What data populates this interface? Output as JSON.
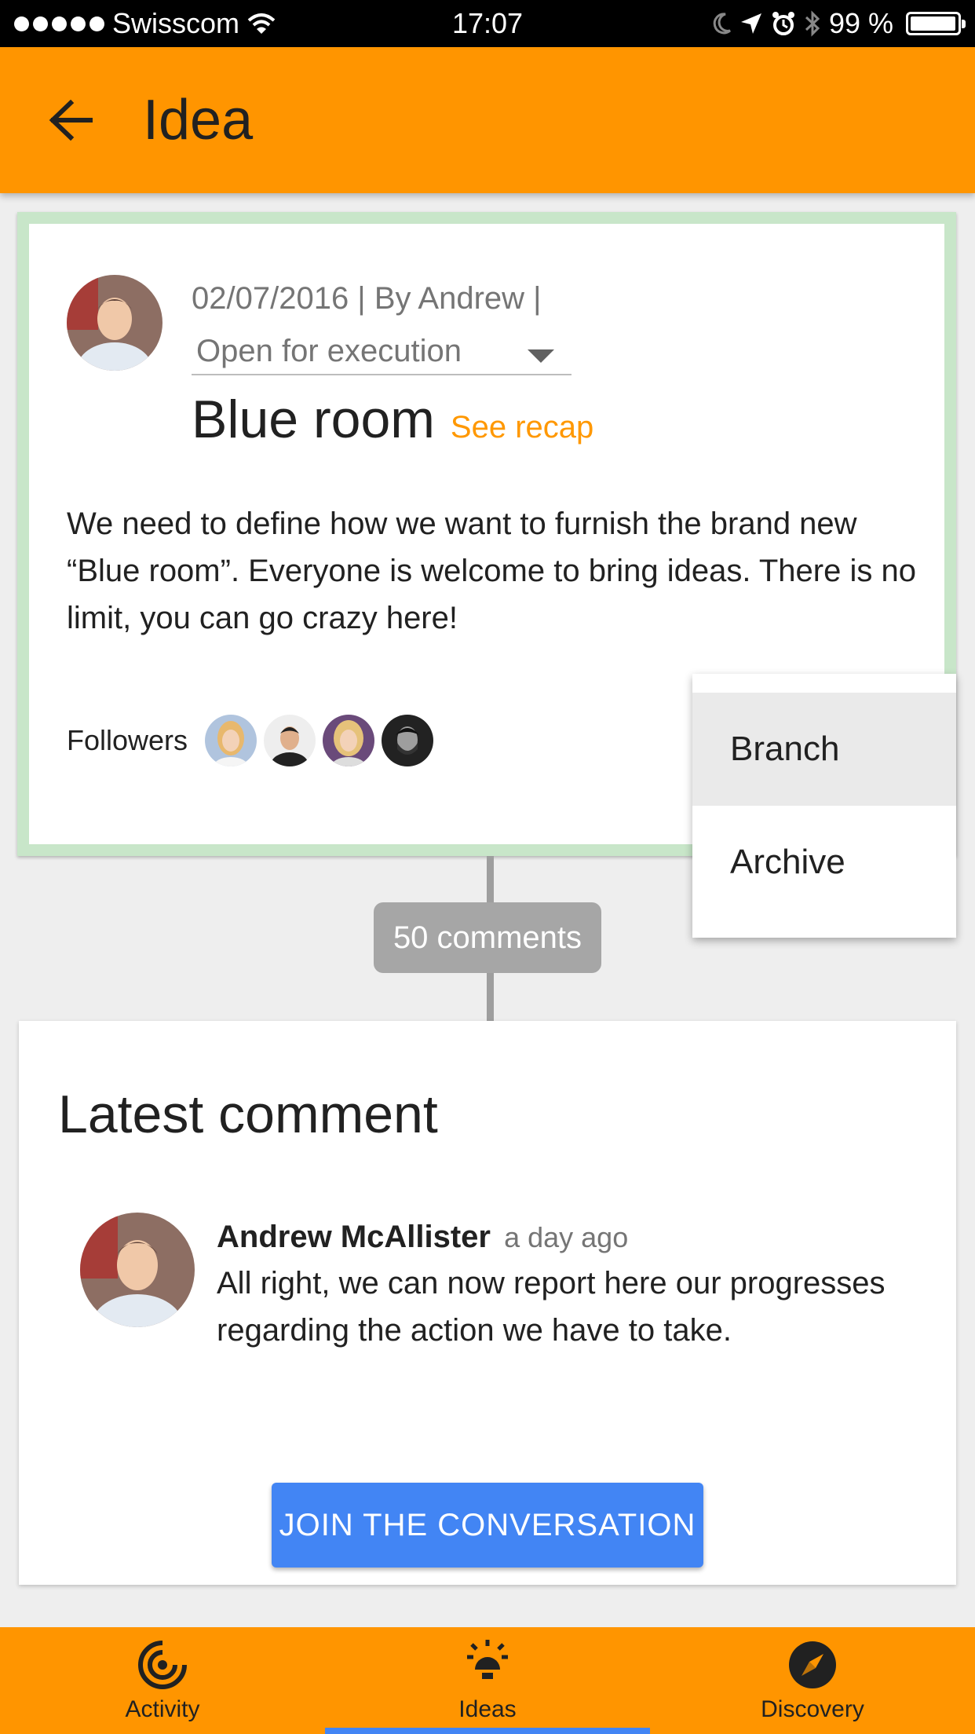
{
  "status_bar": {
    "carrier": "Swisscom",
    "time": "17:07",
    "battery_text": "99 %",
    "battery_level": 0.99,
    "icons": [
      "signal-dots-icon",
      "wifi-icon",
      "moon-icon",
      "location-icon",
      "alarm-icon",
      "bluetooth-icon",
      "battery-icon"
    ]
  },
  "app_bar": {
    "title": "Idea",
    "back_icon": "back-arrow-icon",
    "color": "#ff9500"
  },
  "idea": {
    "meta": "02/07/2016 | By Andrew |",
    "status_value": "Open for execution",
    "title": "Blue room",
    "recap_link": "See recap",
    "description": "We need to define how we want to furnish the brand new “Blue room”. Everyone is welcome to bring ideas. There is no limit, you can go crazy here!",
    "followers_label": "Followers",
    "followers_count": 4,
    "border_color": "#c8e6c9"
  },
  "comments_pill": "50 comments",
  "dropdown_menu": {
    "items": [
      "Branch",
      "Archive"
    ],
    "highlighted": "Branch"
  },
  "latest_comment": {
    "section_title": "Latest comment",
    "author": "Andrew McAllister",
    "time_ago": "a day ago",
    "text": "All right, we can now report here our progresses regarding the action we have to take.",
    "join_button": "JOIN THE CONVERSATION",
    "button_color": "#4285f4"
  },
  "bottom_nav": {
    "items": [
      {
        "label": "Activity",
        "icon": "activity-target-icon"
      },
      {
        "label": "Ideas",
        "icon": "lightbulb-icon"
      },
      {
        "label": "Discovery",
        "icon": "compass-icon"
      }
    ],
    "active": "Ideas"
  }
}
